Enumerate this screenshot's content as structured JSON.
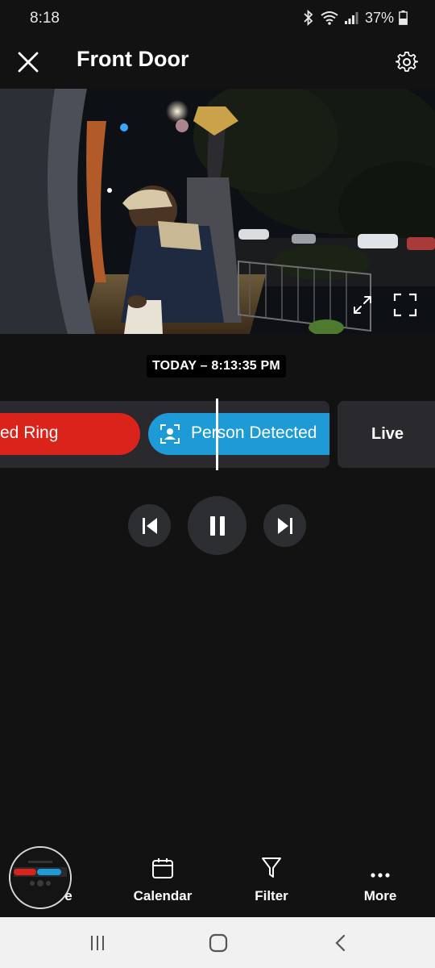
{
  "status_bar": {
    "time": "8:18",
    "battery": "37%",
    "icons": [
      "bluetooth-icon",
      "wifi-icon",
      "signal-icon",
      "battery-icon"
    ]
  },
  "header": {
    "title": "Front Door",
    "close_icon": "close-icon",
    "settings_icon": "gear-icon"
  },
  "video": {
    "expand_icon": "expand-arrows-icon",
    "fullscreen_icon": "fullscreen-icon"
  },
  "timeline": {
    "timestamp": "TODAY – 8:13:35 PM",
    "events": [
      {
        "label": "ed Ring",
        "color": "#d9231b"
      },
      {
        "label": "Person Detected",
        "color": "#1e9bd7"
      }
    ],
    "live_label": "Live"
  },
  "playback": {
    "previous_icon": "skip-previous-icon",
    "pause_icon": "pause-icon",
    "next_icon": "skip-next-icon"
  },
  "bottom_nav": {
    "share_label": "are",
    "calendar_label": "Calendar",
    "filter_label": "Filter",
    "more_label": "More"
  },
  "colors": {
    "background": "#121212",
    "ring_event": "#d9231b",
    "person_event": "#1e9bd7",
    "timeline_bg": "#2a2a2e"
  }
}
